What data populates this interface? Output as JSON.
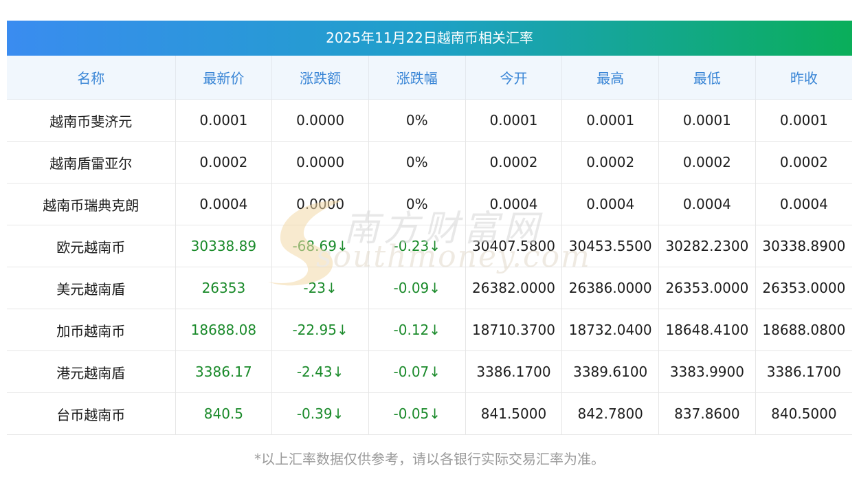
{
  "title": "2025年11月22日越南币相关汇率",
  "columns": [
    "名称",
    "最新价",
    "涨跌额",
    "涨跌幅",
    "今开",
    "最高",
    "最低",
    "昨收"
  ],
  "rows": [
    {
      "name": "越南币斐济元",
      "latest": "0.0001",
      "change": "0.0000",
      "pct": "0%",
      "open": "0.0001",
      "high": "0.0001",
      "low": "0.0001",
      "prev": "0.0001",
      "colored": false
    },
    {
      "name": "越南盾雷亚尔",
      "latest": "0.0002",
      "change": "0.0000",
      "pct": "0%",
      "open": "0.0002",
      "high": "0.0002",
      "low": "0.0002",
      "prev": "0.0002",
      "colored": false
    },
    {
      "name": "越南币瑞典克朗",
      "latest": "0.0004",
      "change": "0.0000",
      "pct": "0%",
      "open": "0.0004",
      "high": "0.0004",
      "low": "0.0004",
      "prev": "0.0004",
      "colored": false
    },
    {
      "name": "欧元越南币",
      "latest": "30338.89",
      "change": "-68.69↓",
      "pct": "-0.23↓",
      "open": "30407.5800",
      "high": "30453.5500",
      "low": "30282.2300",
      "prev": "30338.8900",
      "colored": true
    },
    {
      "name": "美元越南盾",
      "latest": "26353",
      "change": "-23↓",
      "pct": "-0.09↓",
      "open": "26382.0000",
      "high": "26386.0000",
      "low": "26353.0000",
      "prev": "26353.0000",
      "colored": true
    },
    {
      "name": "加币越南币",
      "latest": "18688.08",
      "change": "-22.95↓",
      "pct": "-0.12↓",
      "open": "18710.3700",
      "high": "18732.0400",
      "low": "18648.4100",
      "prev": "18688.0800",
      "colored": true
    },
    {
      "name": "港元越南盾",
      "latest": "3386.17",
      "change": "-2.43↓",
      "pct": "-0.07↓",
      "open": "3386.1700",
      "high": "3389.6100",
      "low": "3383.9900",
      "prev": "3386.1700",
      "colored": true
    },
    {
      "name": "台币越南币",
      "latest": "840.5",
      "change": "-0.39↓",
      "pct": "-0.05↓",
      "open": "841.5000",
      "high": "842.7800",
      "low": "837.8600",
      "prev": "840.5000",
      "colored": true
    }
  ],
  "colors": {
    "accent_green": "#1a8a2a",
    "header_text": "#3a86d6"
  },
  "watermark": {
    "cn": "南方财富网",
    "en": "southmoney.com"
  },
  "note": "*以上汇率数据仅供参考，请以各银行实际交易汇率为准。"
}
